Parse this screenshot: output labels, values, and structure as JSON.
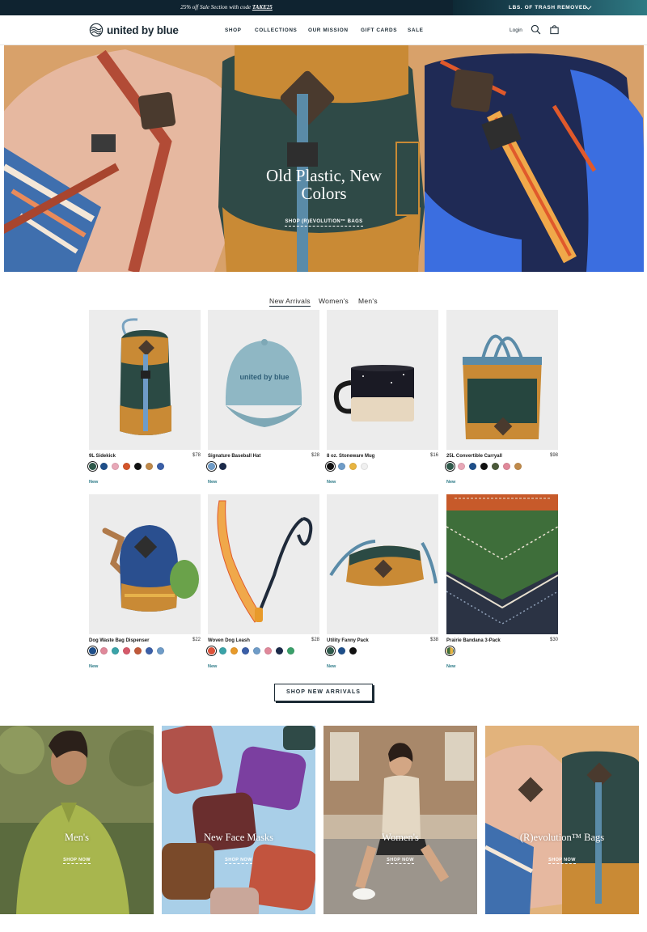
{
  "announcement": {
    "promo_prefix": "25% off Sale Section with code ",
    "promo_code": "TAKE25",
    "trash_label": "LBS. OF TRASH REMOVED"
  },
  "header": {
    "brand": "united by blue",
    "nav": [
      "SHOP",
      "COLLECTIONS",
      "OUR MISSION",
      "GIFT CARDS",
      "SALE"
    ],
    "login": "Login"
  },
  "hero": {
    "title_line1": "Old Plastic, New",
    "title_line2": "Colors",
    "link": "SHOP (R)EVOLUTION™ BAGS"
  },
  "tabs": [
    "New Arrivals",
    "Women's",
    "Men's"
  ],
  "products": [
    {
      "name": "9L Sidekick",
      "price": "$78",
      "badge": "New",
      "swatches": [
        "#2f5a4b",
        "#1e4f8a",
        "#e8a8b8",
        "#d4552a",
        "#111111",
        "#c08a4a",
        "#3b5fa8"
      ]
    },
    {
      "name": "Signature Baseball Hat",
      "price": "$28",
      "badge": "New",
      "swatches": [
        "#6f9cc8",
        "#1b2a4a"
      ]
    },
    {
      "name": "8 oz. Stoneware Mug",
      "price": "$16",
      "badge": "New",
      "swatches": [
        "#111111",
        "#6f9cc8",
        "#e8b440",
        "#f0f0f0"
      ]
    },
    {
      "name": "25L Convertible Carryall",
      "price": "$98",
      "badge": "New",
      "swatches": [
        "#2f5a4b",
        "#e8a8b8",
        "#1e4f8a",
        "#111111",
        "#4b5a3a",
        "#e0889a",
        "#c08a4a"
      ]
    },
    {
      "name": "Dog Waste Bag Dispenser",
      "price": "$22",
      "badge": "New",
      "swatches": [
        "#1e4f8a",
        "#e0889a",
        "#3aa3a8",
        "#d65a6a",
        "#c0593a",
        "#3b5fa8",
        "#6f9cc8"
      ]
    },
    {
      "name": "Woven Dog Leash",
      "price": "$28",
      "badge": "New",
      "swatches": [
        "#e0533a",
        "#3aa3a8",
        "#e89a2a",
        "#3b5fa8",
        "#6f9cc8",
        "#e0889a",
        "#1b2a4a",
        "#3aa06a"
      ]
    },
    {
      "name": "Utility Fanny Pack",
      "price": "$38",
      "badge": "New",
      "swatches": [
        "#2f5a4b",
        "#1e4f8a",
        "#111111"
      ]
    },
    {
      "name": "Prairie Bandana 3-Pack",
      "price": "$30",
      "badge": "New",
      "swatches": [
        "#e8b440"
      ]
    }
  ],
  "cta": "SHOP NEW ARRIVALS",
  "categories": [
    {
      "title": "Men's",
      "link": "SHOP NOW"
    },
    {
      "title": "New Face Masks",
      "link": "SHOP NOW"
    },
    {
      "title": "Women's",
      "link": "SHOP NOW"
    },
    {
      "title": "(R)evolution™ Bags",
      "link": "SHOP NOW"
    }
  ]
}
